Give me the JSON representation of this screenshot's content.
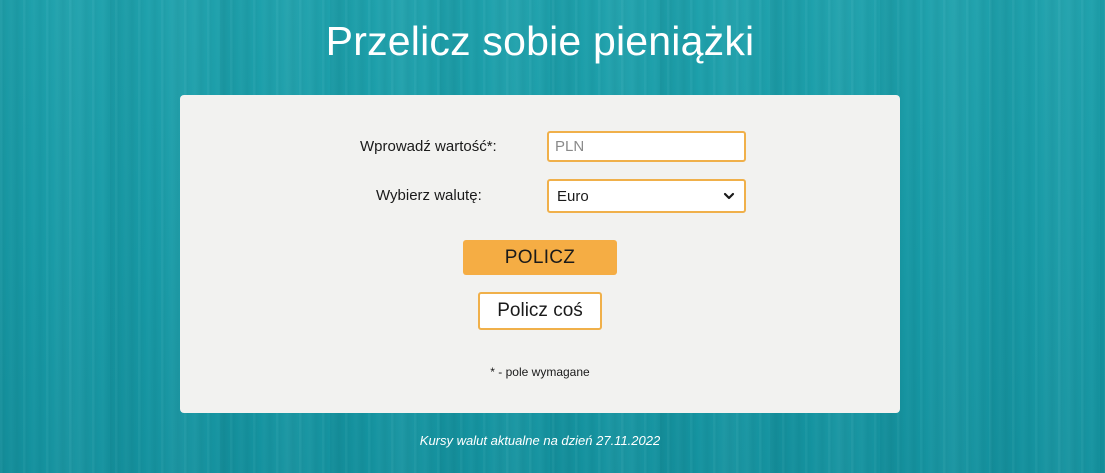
{
  "header": {
    "title": "Przelicz sobie pieniążki"
  },
  "form": {
    "value_label": "Wprowadź wartość*:",
    "value_placeholder": "PLN",
    "value_current": "",
    "currency_label": "Wybierz walutę:",
    "currency_selected": "Euro",
    "currency_icon": "chevron-down-icon",
    "submit_label": "POLICZ",
    "secondary_label": "Policz coś",
    "required_note": "* - pole wymagane"
  },
  "footer": {
    "rates_note": "Kursy walut aktualne na dzień 27.11.2022"
  },
  "colors": {
    "background": "#179aa6",
    "card": "#f2f2f0",
    "accent": "#f5ad44",
    "border": "#f0b04a"
  }
}
